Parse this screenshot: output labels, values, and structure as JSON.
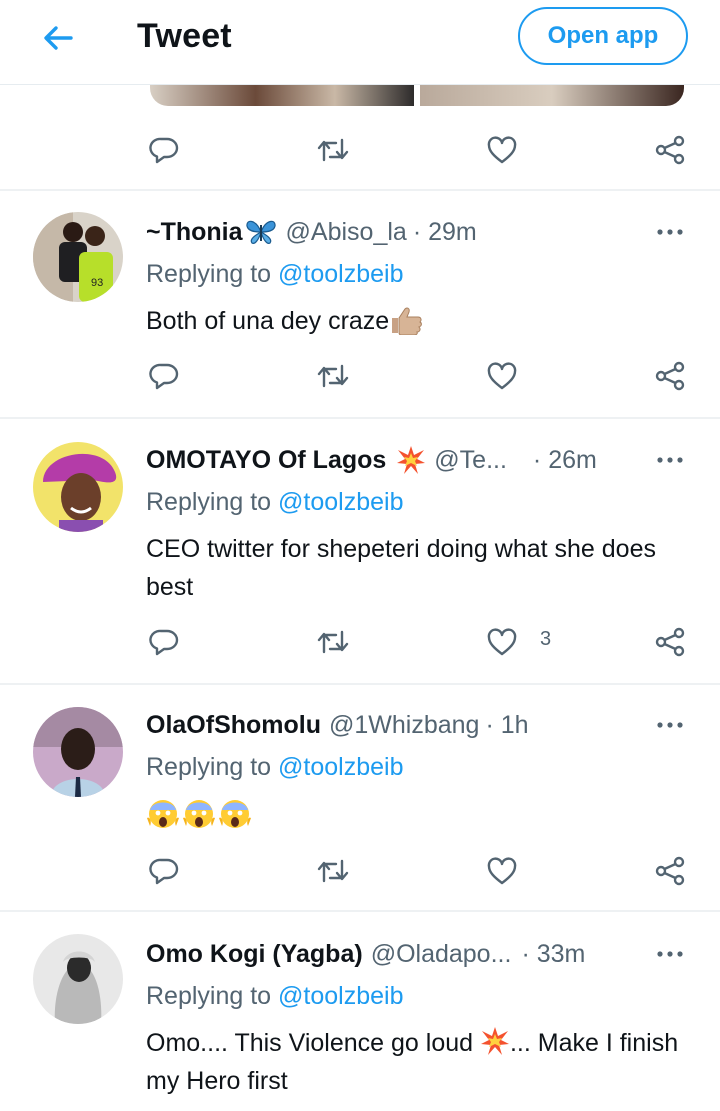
{
  "header": {
    "title": "Tweet",
    "open_app_label": "Open app"
  },
  "tweets": [
    {
      "name": "~Thonia",
      "handle": "@Abiso_la",
      "time": "· 29m",
      "replying_prefix": "Replying to ",
      "replying_to": "@toolzbeib",
      "text": "Both of una dey craze",
      "likes": ""
    },
    {
      "name": "OMOTAYO Of Lagos",
      "handle": "@Te...",
      "time": "· 26m",
      "replying_prefix": "Replying to ",
      "replying_to": "@toolzbeib",
      "text": "CEO twitter for shepeteri doing what she does best",
      "likes": "3"
    },
    {
      "name": "OlaOfShomolu",
      "handle": "@1Whizbang",
      "time": "· 1h",
      "replying_prefix": "Replying to ",
      "replying_to": "@toolzbeib",
      "text": "",
      "likes": ""
    },
    {
      "name": "Omo Kogi (Yagba)",
      "handle": "@Oladapo...",
      "time": "· 33m",
      "replying_prefix": "Replying to ",
      "replying_to": "@toolzbeib",
      "text_part1": "Omo.... This Violence go loud ",
      "text_part2": "... Make I finish my Hero first",
      "likes": ""
    }
  ],
  "icons": [
    "back-arrow-icon",
    "reply-icon",
    "retweet-icon",
    "like-icon",
    "share-icon",
    "more-icon",
    "butterfly-emoji",
    "thumbs-up-emoji",
    "collision-emoji",
    "screaming-face-emoji"
  ],
  "colors": {
    "accent": "#1d9bf0",
    "secondary_text": "#536471",
    "primary_text": "#0f1419"
  }
}
